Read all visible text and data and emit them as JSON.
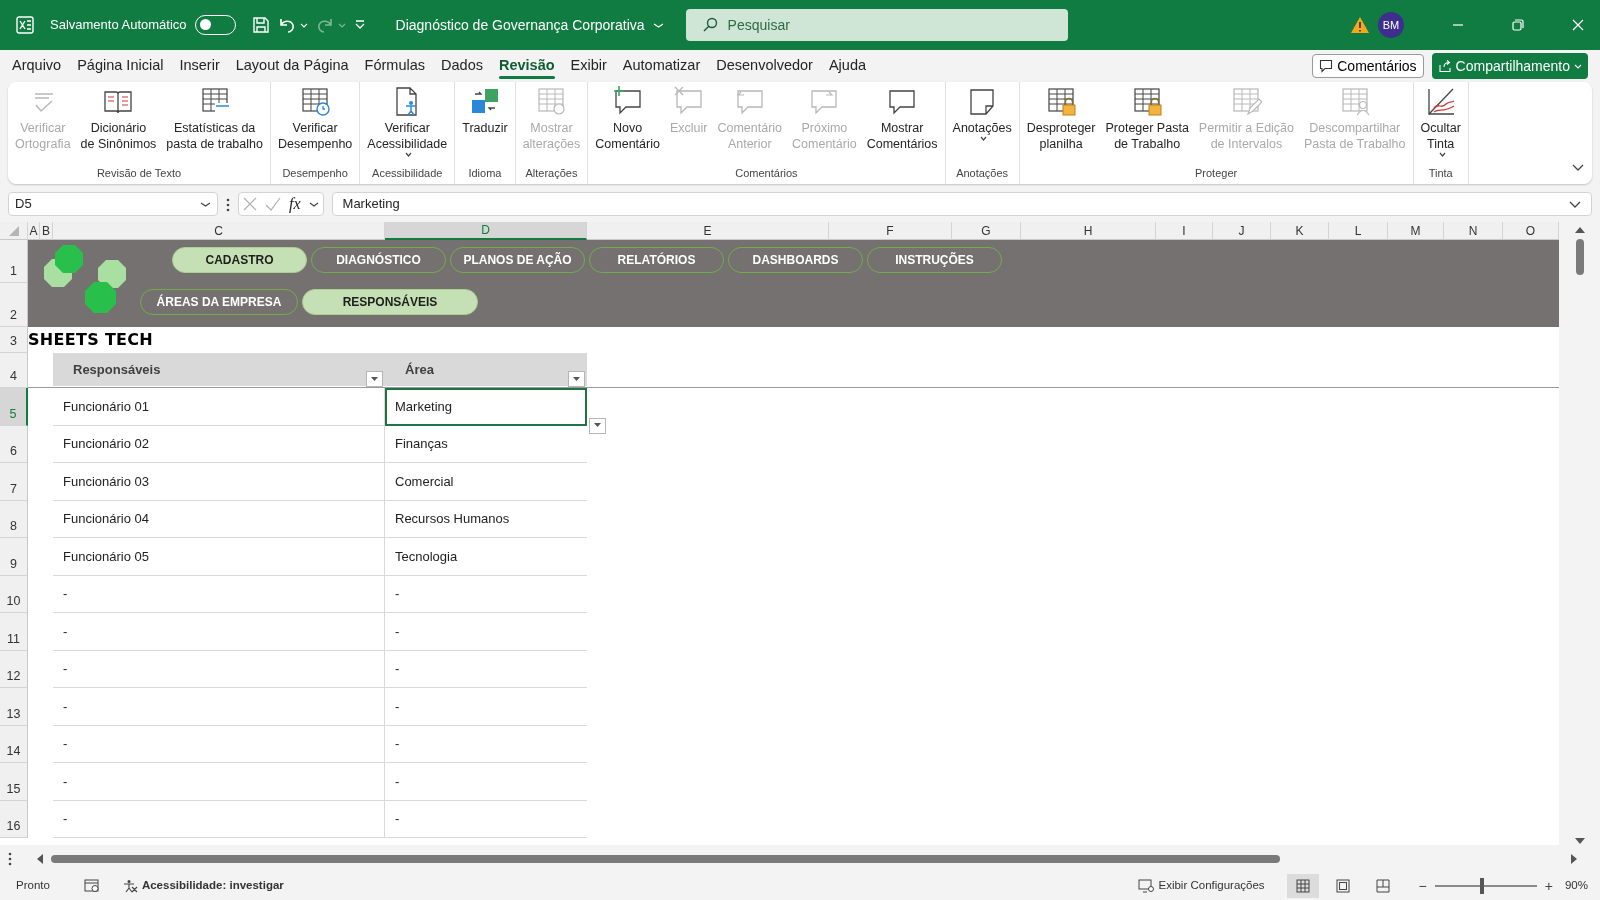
{
  "title_bar": {
    "autosave_label": "Salvamento Automático",
    "autosave_on": false,
    "quick_access": [
      {
        "kind": "save",
        "disabled": false
      },
      {
        "kind": "undo",
        "disabled": false
      },
      {
        "kind": "redo",
        "disabled": true
      },
      {
        "kind": "customize",
        "disabled": false
      }
    ],
    "document_title": "Diagnóstico de Governança Corporativa",
    "search_placeholder": "Pesquisar",
    "avatar": "BM"
  },
  "menu_tabs": [
    {
      "label": "Arquivo",
      "selected": false
    },
    {
      "label": "Página Inicial",
      "selected": false
    },
    {
      "label": "Inserir",
      "selected": false
    },
    {
      "label": "Layout da Página",
      "selected": false
    },
    {
      "label": "Fórmulas",
      "selected": false
    },
    {
      "label": "Dados",
      "selected": false
    },
    {
      "label": "Revisão",
      "selected": true
    },
    {
      "label": "Exibir",
      "selected": false
    },
    {
      "label": "Automatizar",
      "selected": false
    },
    {
      "label": "Desenvolvedor",
      "selected": false
    },
    {
      "label": "Ajuda",
      "selected": false
    }
  ],
  "header_buttons": {
    "comments": "Comentários",
    "share": "Compartilhamento"
  },
  "ribbon_groups": [
    {
      "label": "Revisão de Texto",
      "commands": [
        {
          "lines": [
            "Verificar",
            "Ortografia"
          ],
          "disabled": true,
          "dropdown": false
        },
        {
          "lines": [
            "Dicionário",
            "de Sinônimos"
          ],
          "disabled": false,
          "dropdown": false
        },
        {
          "lines": [
            "Estatísticas da",
            "pasta de trabalho"
          ],
          "disabled": false,
          "dropdown": false
        }
      ]
    },
    {
      "label": "Desempenho",
      "commands": [
        {
          "lines": [
            "Verificar",
            "Desempenho"
          ],
          "disabled": false,
          "dropdown": false
        }
      ]
    },
    {
      "label": "Acessibilidade",
      "commands": [
        {
          "lines": [
            "Verificar",
            "Acessibilidade"
          ],
          "disabled": false,
          "dropdown": true
        }
      ]
    },
    {
      "label": "Idioma",
      "commands": [
        {
          "lines": [
            "Traduzir"
          ],
          "disabled": false,
          "dropdown": false
        }
      ]
    },
    {
      "label": "Alterações",
      "commands": [
        {
          "lines": [
            "Mostrar",
            "alterações"
          ],
          "disabled": true,
          "dropdown": false
        }
      ]
    },
    {
      "label": "Comentários",
      "commands": [
        {
          "lines": [
            "Novo",
            "Comentário"
          ],
          "disabled": false,
          "dropdown": false
        },
        {
          "lines": [
            "Excluir"
          ],
          "disabled": true,
          "dropdown": false
        },
        {
          "lines": [
            "Comentário",
            "Anterior"
          ],
          "disabled": true,
          "dropdown": false
        },
        {
          "lines": [
            "Próximo",
            "Comentário"
          ],
          "disabled": true,
          "dropdown": false
        },
        {
          "lines": [
            "Mostrar",
            "Comentários"
          ],
          "disabled": false,
          "dropdown": false
        }
      ]
    },
    {
      "label": "Anotações",
      "commands": [
        {
          "lines": [
            "Anotações"
          ],
          "disabled": false,
          "dropdown": true
        }
      ]
    },
    {
      "label": "Proteger",
      "commands": [
        {
          "lines": [
            "Desproteger",
            "planilha"
          ],
          "disabled": false,
          "dropdown": false
        },
        {
          "lines": [
            "Proteger Pasta",
            "de Trabalho"
          ],
          "disabled": false,
          "dropdown": false
        },
        {
          "lines": [
            "Permitir a Edição",
            "de Intervalos"
          ],
          "disabled": true,
          "dropdown": false
        },
        {
          "lines": [
            "Descompartilhar",
            "Pasta de Trabalho"
          ],
          "disabled": true,
          "dropdown": false
        }
      ]
    },
    {
      "label": "Tinta",
      "commands": [
        {
          "lines": [
            "Ocultar",
            "Tinta"
          ],
          "disabled": false,
          "dropdown": true
        }
      ]
    }
  ],
  "formula_bar": {
    "name_box": "D5",
    "function_label": "fx",
    "formula": "Marketing"
  },
  "columns": [
    {
      "label": "A",
      "selected": false
    },
    {
      "label": "B",
      "selected": false
    },
    {
      "label": "C",
      "selected": false
    },
    {
      "label": "D",
      "selected": true
    },
    {
      "label": "E",
      "selected": false
    },
    {
      "label": "F",
      "selected": false
    },
    {
      "label": "G",
      "selected": false
    },
    {
      "label": "H",
      "selected": false
    },
    {
      "label": "I",
      "selected": false
    },
    {
      "label": "J",
      "selected": false
    },
    {
      "label": "K",
      "selected": false
    },
    {
      "label": "L",
      "selected": false
    },
    {
      "label": "M",
      "selected": false
    },
    {
      "label": "N",
      "selected": false
    },
    {
      "label": "O",
      "selected": false
    }
  ],
  "row_numbers": [
    {
      "label": "1",
      "selected": false
    },
    {
      "label": "2",
      "selected": false
    },
    {
      "label": "3",
      "selected": false
    },
    {
      "label": "4",
      "selected": false
    },
    {
      "label": "5",
      "selected": true
    },
    {
      "label": "6",
      "selected": false
    },
    {
      "label": "7",
      "selected": false
    },
    {
      "label": "8",
      "selected": false
    },
    {
      "label": "9",
      "selected": false
    },
    {
      "label": "10",
      "selected": false
    },
    {
      "label": "11",
      "selected": false
    },
    {
      "label": "12",
      "selected": false
    },
    {
      "label": "13",
      "selected": false
    },
    {
      "label": "14",
      "selected": false
    },
    {
      "label": "15",
      "selected": false
    },
    {
      "label": "16",
      "selected": false
    }
  ],
  "nav_buttons": [
    {
      "label": "CADASTRO",
      "selected": true
    },
    {
      "label": "DIAGNÓSTICO",
      "selected": false
    },
    {
      "label": "PLANOS DE AÇÃO",
      "selected": false
    },
    {
      "label": "RELATÓRIOS",
      "selected": false
    },
    {
      "label": "DASHBOARDS",
      "selected": false
    },
    {
      "label": "INSTRUÇÕES",
      "selected": false
    }
  ],
  "sub_nav_buttons": [
    {
      "label": "ÁREAS DA EMPRESA",
      "selected": false
    },
    {
      "label": "RESPONSÁVEIS",
      "selected": true
    }
  ],
  "brand": "SHEETS TECH",
  "table": {
    "columns": [
      "Responsáveis",
      "Área"
    ],
    "rows": [
      {
        "cells": [
          {
            "text": "Funcionário 01",
            "selected": false
          },
          {
            "text": "Marketing",
            "selected": true
          }
        ]
      },
      {
        "cells": [
          {
            "text": "Funcionário 02",
            "selected": false
          },
          {
            "text": "Finanças",
            "selected": false
          }
        ]
      },
      {
        "cells": [
          {
            "text": "Funcionário 03",
            "selected": false
          },
          {
            "text": "Comercial",
            "selected": false
          }
        ]
      },
      {
        "cells": [
          {
            "text": "Funcionário 04",
            "selected": false
          },
          {
            "text": "Recursos Humanos",
            "selected": false
          }
        ]
      },
      {
        "cells": [
          {
            "text": "Funcionário 05",
            "selected": false
          },
          {
            "text": "Tecnologia",
            "selected": false
          }
        ]
      },
      {
        "cells": [
          {
            "text": "-",
            "selected": false
          },
          {
            "text": "-",
            "selected": false
          }
        ]
      },
      {
        "cells": [
          {
            "text": "-",
            "selected": false
          },
          {
            "text": "-",
            "selected": false
          }
        ]
      },
      {
        "cells": [
          {
            "text": "-",
            "selected": false
          },
          {
            "text": "-",
            "selected": false
          }
        ]
      },
      {
        "cells": [
          {
            "text": "-",
            "selected": false
          },
          {
            "text": "-",
            "selected": false
          }
        ]
      },
      {
        "cells": [
          {
            "text": "-",
            "selected": false
          },
          {
            "text": "-",
            "selected": false
          }
        ]
      },
      {
        "cells": [
          {
            "text": "-",
            "selected": false
          },
          {
            "text": "-",
            "selected": false
          }
        ]
      },
      {
        "cells": [
          {
            "text": "-",
            "selected": false
          },
          {
            "text": "-",
            "selected": false
          }
        ]
      }
    ]
  },
  "status_bar": {
    "ready": "Pronto",
    "accessibility": "Acessibilidade: investigar",
    "display_settings": "Exibir Configurações",
    "views": [
      {
        "kind": "normal",
        "selected": true
      },
      {
        "kind": "page_layout",
        "selected": false
      },
      {
        "kind": "page_break",
        "selected": false
      }
    ],
    "zoom_out": "−",
    "zoom_in": "+",
    "zoom": {
      "level": 0.46
    },
    "zoom_text": "90%"
  }
}
